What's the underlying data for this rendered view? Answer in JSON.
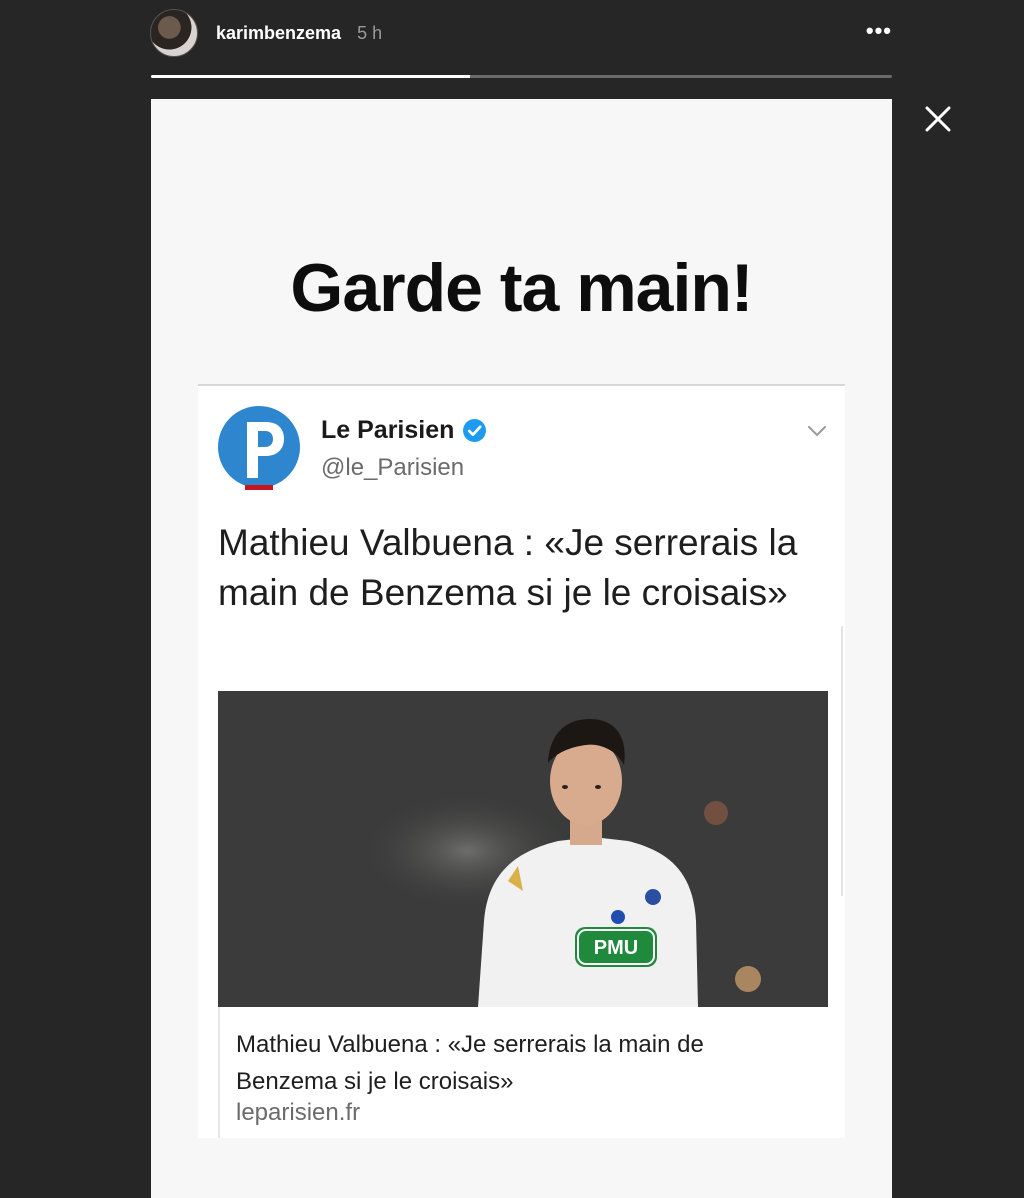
{
  "story_header": {
    "username": "karimbenzema",
    "time_ago": "5 h",
    "more_label": "•••",
    "progress": 0.43
  },
  "story": {
    "caption": "Garde ta main!"
  },
  "tweet": {
    "display_name": "Le Parisien",
    "handle": "@le_Parisien",
    "text": "Mathieu Valbuena : «Je serrerais la main de Benzema si je le croisais»",
    "card": {
      "title": "Mathieu Valbuena : «Je serrerais la main de Benzema si je le croisais»",
      "domain": "leparisien.fr",
      "image_jersey_text": "PMU"
    }
  },
  "colors": {
    "background": "#262626",
    "story_bg": "#f7f7f7",
    "logo_blue": "#2e86cf",
    "logo_red": "#c4161c",
    "verified_blue": "#1d9bf0",
    "pmu_green": "#1f8a3b"
  },
  "icons": [
    "close-icon",
    "more-icon",
    "verified-icon",
    "chevron-down-icon",
    "le-parisien-logo"
  ]
}
